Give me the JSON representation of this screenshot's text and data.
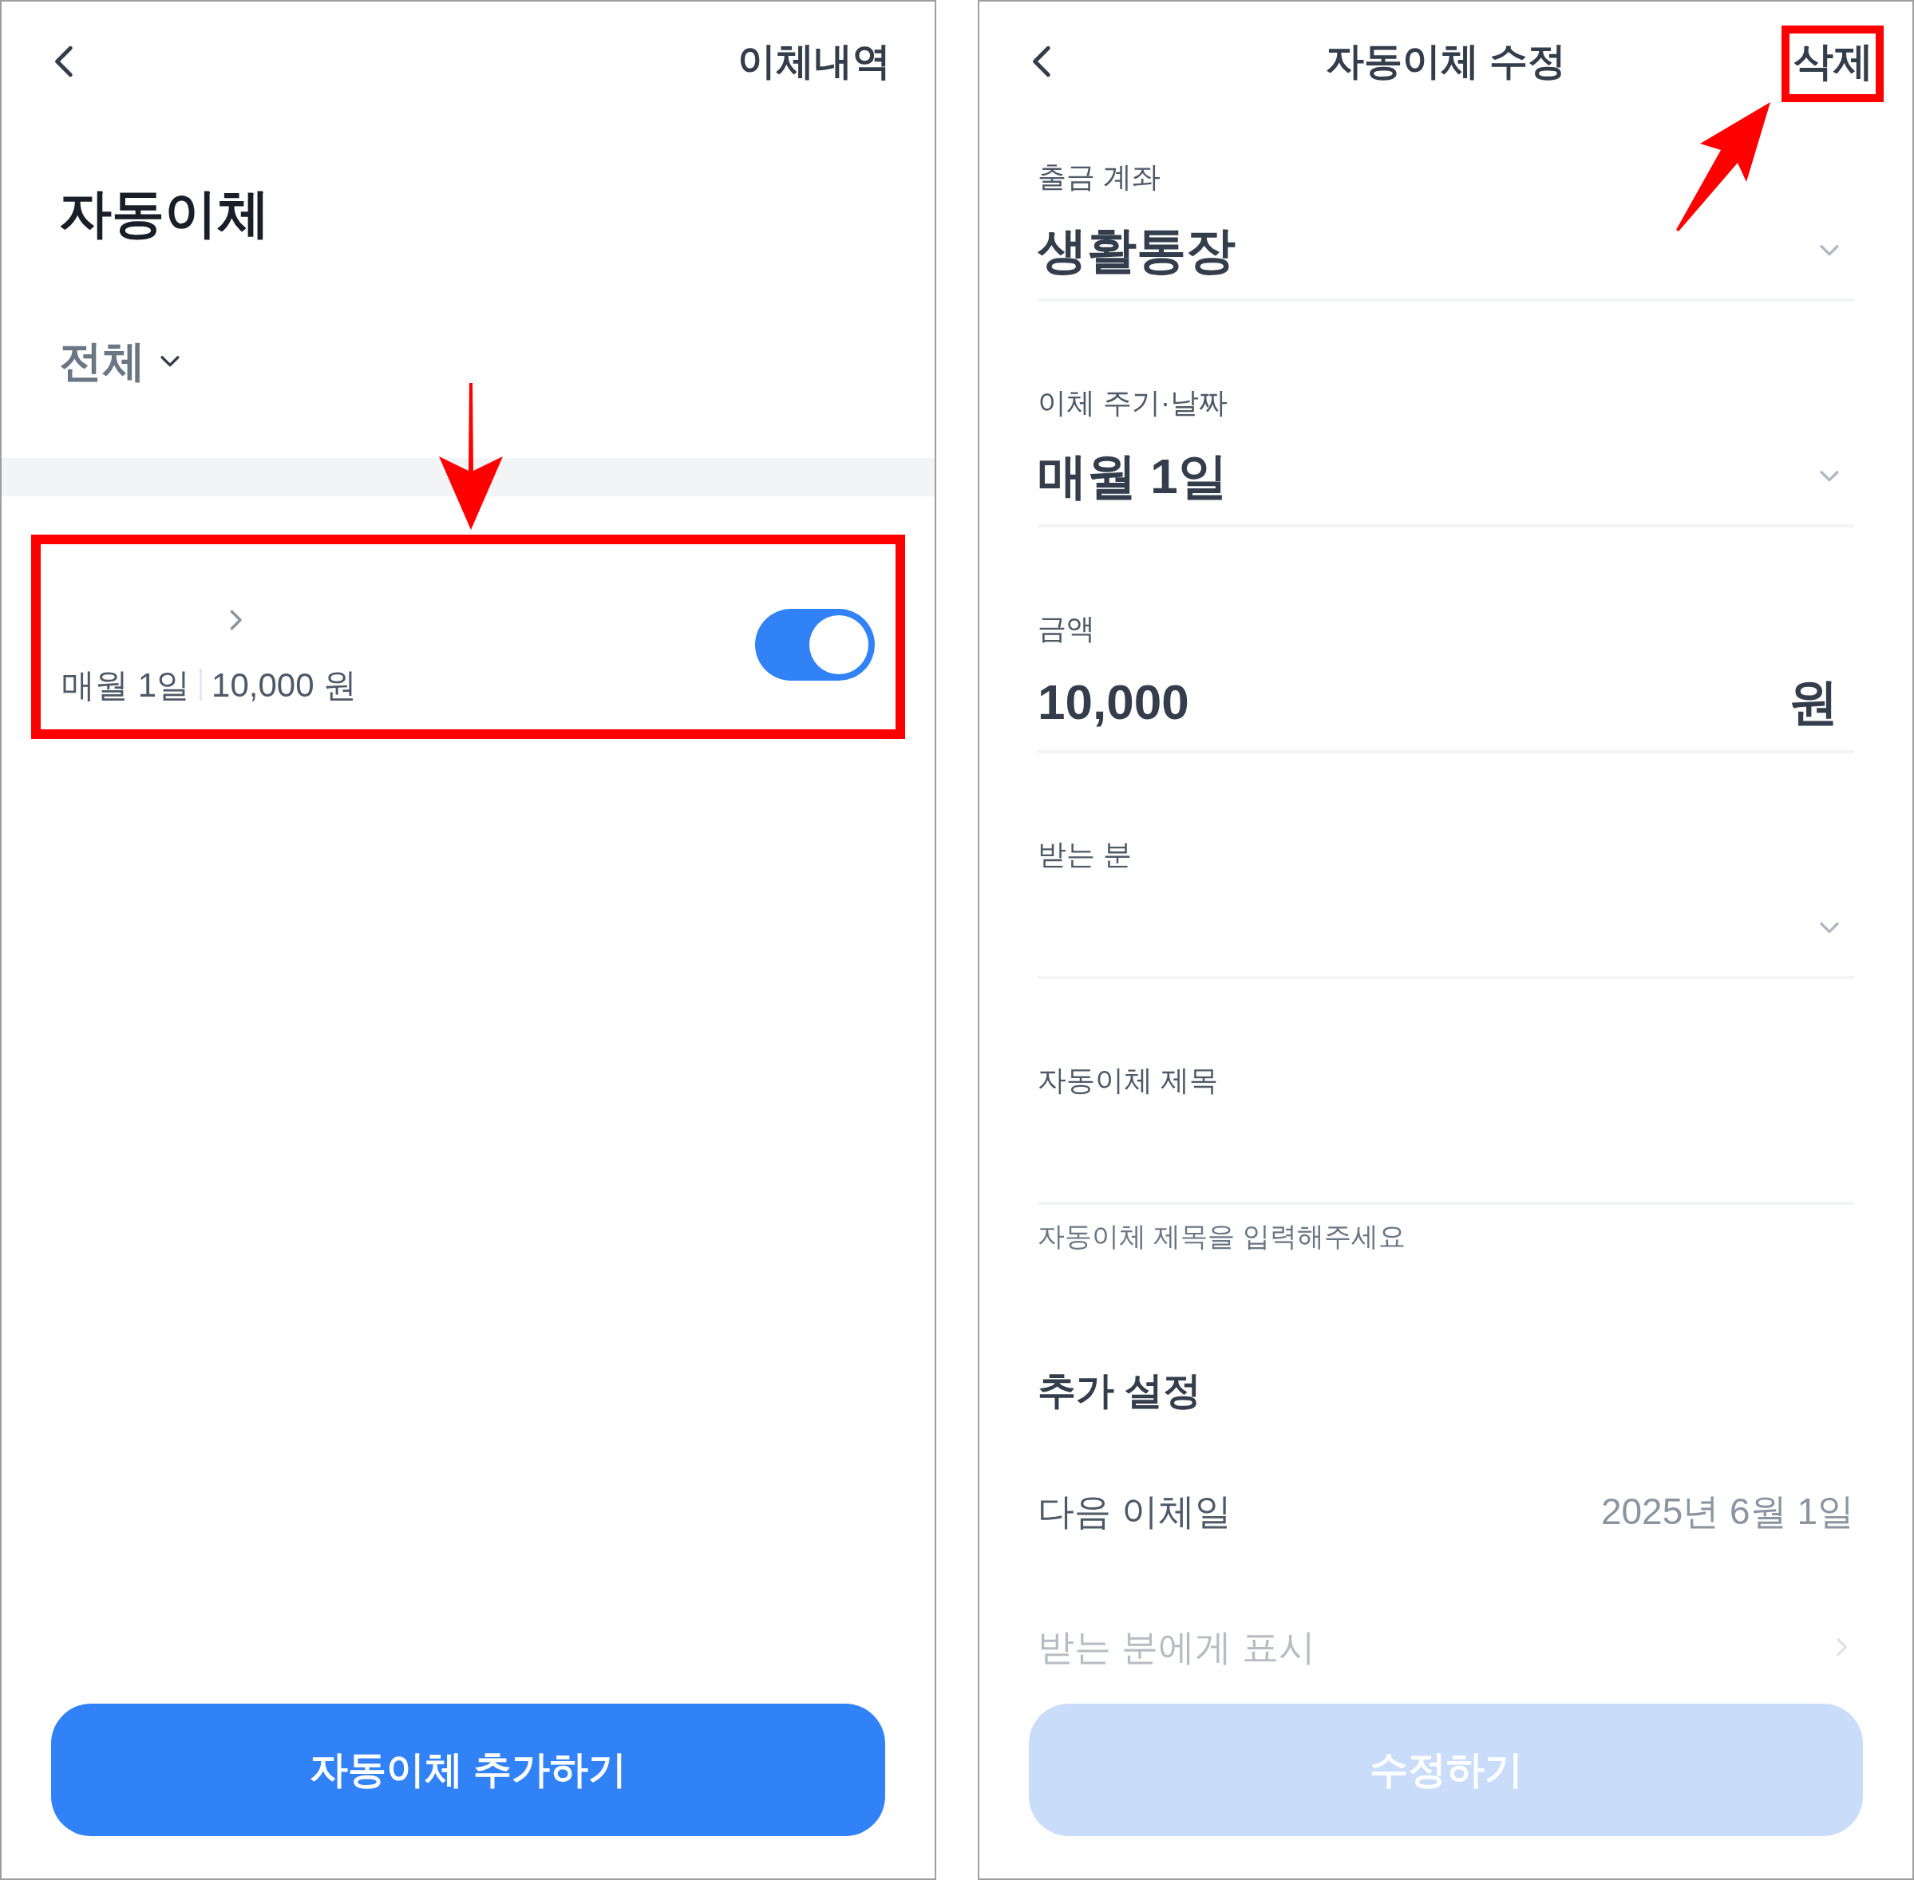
{
  "left_screen": {
    "header_link": "이체내역",
    "title": "자동이체",
    "filter": {
      "label": "전체"
    },
    "transfers": [
      {
        "schedule": "매월 1일",
        "amount": "10,000 원",
        "on": true,
        "highlighted": true
      }
    ],
    "primary_button": "자동이체 추가하기"
  },
  "right_screen": {
    "title": "자동이체 수정",
    "delete_button": {
      "label": "삭제",
      "highlighted": true
    },
    "fields": [
      {
        "kind": "select",
        "label": "출금 계좌",
        "value": "생활통장"
      },
      {
        "kind": "select",
        "label": "이체 주기·날짜",
        "value": "매월 1일"
      },
      {
        "kind": "amount",
        "label": "금액",
        "value": "10,000",
        "unit": "원"
      },
      {
        "kind": "select",
        "label": "받는 분"
      },
      {
        "kind": "text",
        "label": "자동이체 제목",
        "hint": "자동이체 제목을 입력해주세요"
      }
    ],
    "section_title": "추가 설정",
    "settings": [
      {
        "kind": "value",
        "label": "다음 이체일",
        "value": "2025년 6월 1일",
        "faded": false
      },
      {
        "kind": "link",
        "label": "받는 분에게 표시",
        "faded": true
      }
    ],
    "submit_button": {
      "label": "수정하기",
      "disabled": true
    }
  }
}
